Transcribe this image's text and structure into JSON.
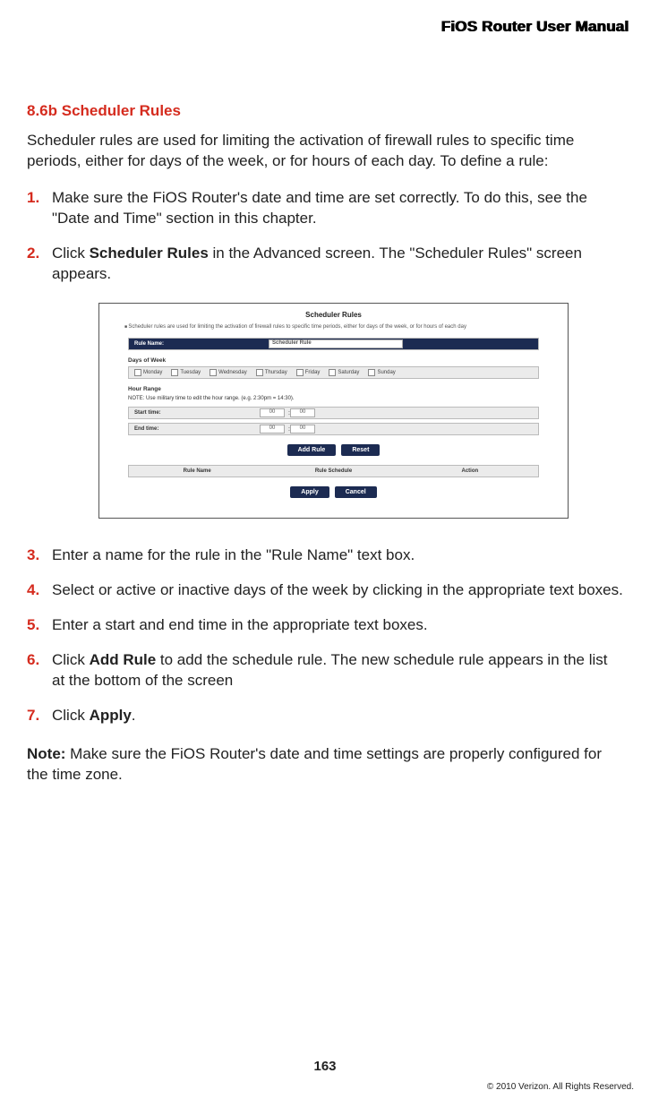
{
  "header": {
    "title": "FiOS Router User Manual"
  },
  "section": {
    "title": "8.6b  Scheduler Rules"
  },
  "intro": "Scheduler rules are used for limiting the activation of firewall rules to specific time periods, either for days of the week, or for hours of each day.  To define a rule:",
  "steps": [
    {
      "text_pre": "Make sure the FiOS Router's date and time are set correctly. To do this, see the \"Date and Time\" section in this chapter."
    },
    {
      "text_pre": "Click ",
      "bold": "Scheduler Rules",
      "text_post": " in the Advanced screen. The \"Scheduler Rules\" screen appears."
    },
    {
      "text_pre": "Enter a name for the rule in the \"Rule Name\" text box."
    },
    {
      "text_pre": "Select or active or inactive days of the week by clicking in the appropriate text boxes."
    },
    {
      "text_pre": "Enter a start and end time in the appropriate text boxes."
    },
    {
      "text_pre": "Click ",
      "bold": "Add Rule",
      "text_post": " to add the schedule rule. The new schedule rule appears in the list at the bottom of the screen"
    },
    {
      "text_pre": "Click ",
      "bold": "Apply",
      "text_post": "."
    }
  ],
  "note": {
    "label": "Note:",
    "text": " Make sure the FiOS Router's date and time settings are properly configured for the time zone."
  },
  "screenshot": {
    "title": "Scheduler Rules",
    "intro": "Scheduler rules are used for limiting the activation of firewall rules to specific time periods, either for days of the week, or for hours of each day",
    "rule_name_label": "Rule Name:",
    "rule_name_value": "Scheduler Rule",
    "days_label": "Days of Week",
    "days": [
      "Monday",
      "Tuesday",
      "Wednesday",
      "Thursday",
      "Friday",
      "Saturday",
      "Sunday"
    ],
    "hour_label": "Hour Range",
    "hour_note": "NOTE: Use military time to edit the hour range. (e.g. 2:30pm = 14:30).",
    "start_label": "Start time:",
    "end_label": "End time:",
    "start_h": "00",
    "start_m": "00",
    "end_h": "00",
    "end_m": "00",
    "btn_add": "Add Rule",
    "btn_reset": "Reset",
    "thead": [
      "Rule Name",
      "Rule Schedule",
      "Action"
    ],
    "btn_apply": "Apply",
    "btn_cancel": "Cancel"
  },
  "page_number": "163",
  "copyright": "© 2010 Verizon. All Rights Reserved."
}
